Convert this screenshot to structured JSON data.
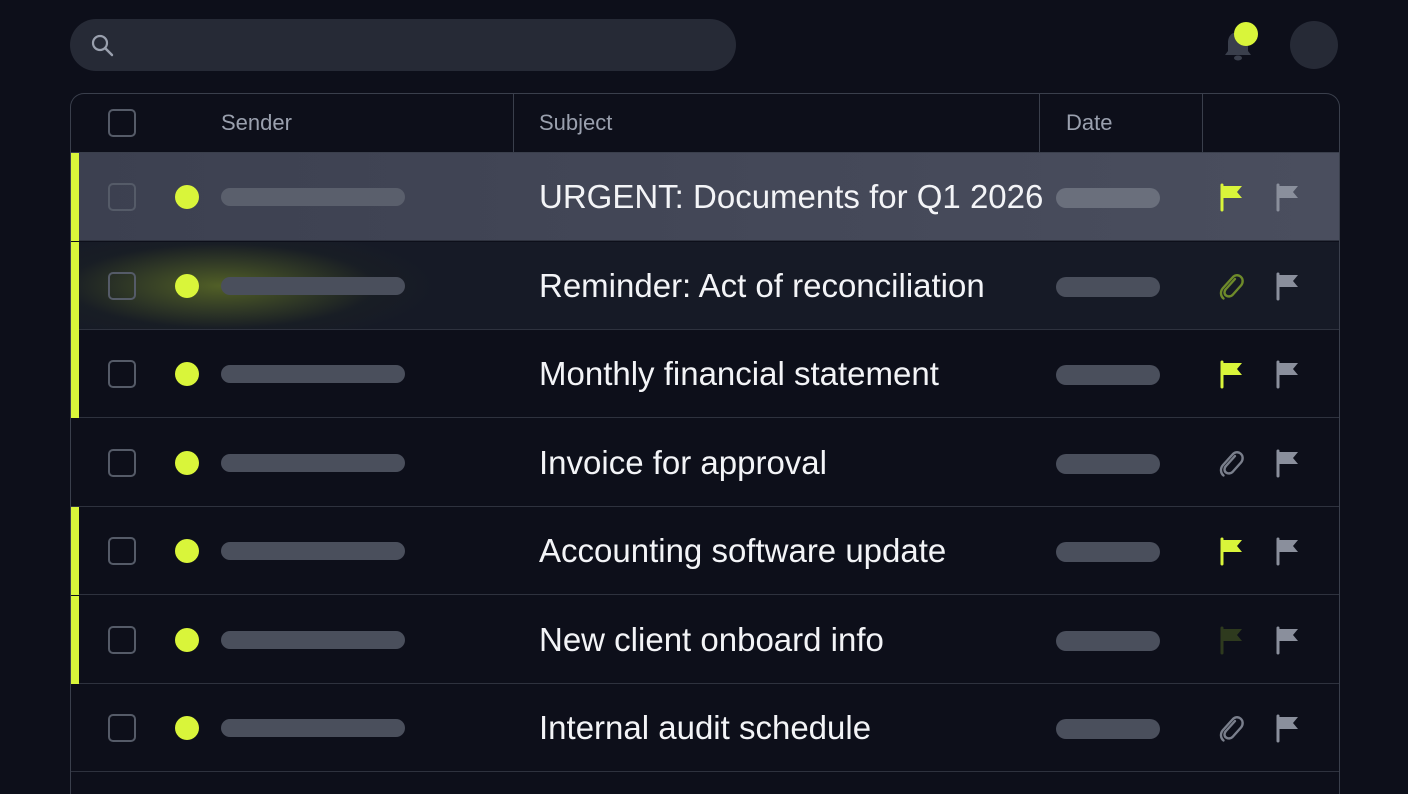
{
  "search": {
    "value": "",
    "placeholder": ""
  },
  "header": {
    "notification_icon": "bell-icon",
    "notification_badge": true,
    "avatar": "avatar"
  },
  "table": {
    "columns": [
      "Sender",
      "Subject",
      "Date",
      ""
    ],
    "rows": [
      {
        "subject": "URGENT: Documents for Q1 2026",
        "unread": true,
        "accent": true,
        "selected": true,
        "highlight": false,
        "action_icon": "flag-icon",
        "action_active": true
      },
      {
        "subject": "Reminder: Act of reconciliation",
        "unread": true,
        "accent": true,
        "selected": false,
        "highlight": true,
        "action_icon": "paperclip-icon",
        "action_active": true
      },
      {
        "subject": "Monthly financial statement",
        "unread": true,
        "accent": true,
        "selected": false,
        "highlight": false,
        "action_icon": "flag-icon",
        "action_active": true
      },
      {
        "subject": "Invoice for approval",
        "unread": true,
        "accent": false,
        "selected": false,
        "highlight": false,
        "action_icon": "paperclip-icon",
        "action_active": false
      },
      {
        "subject": "Accounting software update",
        "unread": true,
        "accent": true,
        "selected": false,
        "highlight": false,
        "action_icon": "flag-icon",
        "action_active": true
      },
      {
        "subject": "New client onboard info",
        "unread": true,
        "accent": true,
        "selected": false,
        "highlight": false,
        "action_icon": "flag-icon",
        "action_active": false
      },
      {
        "subject": "Internal audit schedule",
        "unread": true,
        "accent": false,
        "selected": false,
        "highlight": false,
        "action_icon": "paperclip-icon",
        "action_active": false
      }
    ]
  },
  "colors": {
    "background": "#0d0f1a",
    "accent": "#d9f53a",
    "muted_pill": "#4a4f5c",
    "border": "#3a3f4c"
  }
}
